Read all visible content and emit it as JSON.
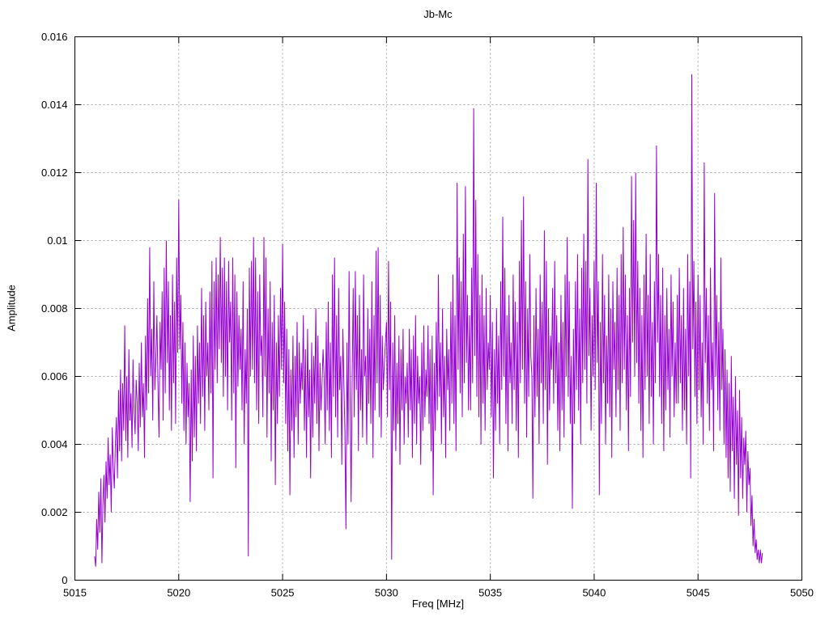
{
  "figure": {
    "background": "#ffffff",
    "frame_color": "#000000",
    "grid_color": "#a6a6a6"
  },
  "chart_data": {
    "type": "line",
    "title": "Jb-Mc",
    "xlabel": "Freq [MHz]",
    "ylabel": "Amplitude",
    "xlim": [
      5015,
      5050
    ],
    "ylim": [
      0,
      0.016
    ],
    "grid": true,
    "legend_position": "none",
    "x_ticks": [
      5015,
      5020,
      5025,
      5030,
      5035,
      5040,
      5045,
      5050
    ],
    "x_tick_labels": [
      "5015",
      "5020",
      "5025",
      "5030",
      "5035",
      "5040",
      "5045",
      "5050"
    ],
    "y_ticks": [
      0,
      0.002,
      0.004,
      0.006,
      0.008,
      0.01,
      0.012,
      0.014,
      0.016
    ],
    "y_tick_labels": [
      "0",
      "0.002",
      "0.004",
      "0.006",
      "0.008",
      "0.01",
      "0.012",
      "0.014",
      "0.016"
    ],
    "series": [
      {
        "name": "Jb-Mc",
        "color": "#9400d3",
        "x_start": 5015.95,
        "x_step": 0.05,
        "y_scale": 0.0001,
        "values": [
          7,
          4,
          18,
          9,
          26,
          14,
          30,
          5,
          22,
          31,
          17,
          35,
          24,
          42,
          28,
          37,
          20,
          45,
          33,
          27,
          40,
          48,
          30,
          56,
          38,
          62,
          35,
          58,
          44,
          75,
          41,
          60,
          36,
          68,
          47,
          55,
          39,
          65,
          50,
          43,
          59,
          52,
          38,
          64,
          45,
          70,
          48,
          58,
          36,
          72,
          50,
          83,
          55,
          98,
          60,
          74,
          47,
          88,
          56,
          66,
          78,
          58,
          42,
          76,
          62,
          85,
          47,
          92,
          55,
          100,
          64,
          88,
          50,
          78,
          44,
          90,
          58,
          82,
          46,
          95,
          67,
          112,
          68,
          84,
          52,
          76,
          44,
          70,
          40,
          64,
          48,
          58,
          23,
          62,
          35,
          72,
          42,
          66,
          38,
          75,
          52,
          70,
          46,
          86,
          54,
          78,
          44,
          82,
          60,
          70,
          50,
          85,
          55,
          94,
          30,
          88,
          62,
          95,
          58,
          90,
          68,
          101,
          64,
          92,
          54,
          95,
          60,
          88,
          50,
          94,
          70,
          82,
          47,
          95,
          55,
          90,
          33,
          85,
          57,
          78,
          62,
          74,
          50,
          88,
          40,
          68,
          52,
          80,
          7,
          92,
          60,
          94,
          62,
          101,
          58,
          95,
          50,
          85,
          46,
          90,
          66,
          72,
          48,
          101,
          60,
          95,
          42,
          80,
          55,
          88,
          35,
          76,
          50,
          84,
          28,
          70,
          46,
          78,
          54,
          86,
          62,
          99,
          58,
          82,
          46,
          74,
          38,
          68,
          25,
          62,
          44,
          72,
          36,
          66,
          48,
          76,
          40,
          70,
          52,
          64,
          56,
          78,
          44,
          68,
          36,
          74,
          48,
          62,
          30,
          70,
          42,
          66,
          52,
          80,
          46,
          72,
          38,
          64,
          50,
          58,
          68,
          60,
          40,
          76,
          50,
          82,
          44,
          70,
          36,
          90,
          54,
          95,
          48,
          78,
          42,
          86,
          56,
          66,
          34,
          74,
          58,
          44,
          15,
          70,
          40,
          91,
          52,
          23,
          60,
          86,
          48,
          91,
          56,
          78,
          38,
          84,
          50,
          68,
          42,
          90,
          60,
          66,
          40,
          80,
          52,
          74,
          46,
          88,
          36,
          78,
          50,
          97,
          58,
          98,
          48,
          84,
          42,
          72,
          56,
          64,
          70,
          76,
          48,
          94,
          56,
          82,
          6,
          70,
          44,
          78,
          38,
          64,
          46,
          72,
          34,
          68,
          50,
          74,
          40,
          60,
          52,
          64,
          42,
          74,
          50,
          68,
          36,
          72,
          46,
          78,
          40,
          66,
          52,
          60,
          34,
          70,
          44,
          75,
          48,
          62,
          54,
          75,
          46,
          68,
          38,
          72,
          25,
          64,
          44,
          76,
          50,
          90,
          54,
          70,
          40,
          80,
          48,
          66,
          36,
          74,
          56,
          68,
          44,
          82,
          52,
          90,
          46,
          78,
          38,
          117,
          62,
          95,
          55,
          88,
          48,
          102,
          58,
          116,
          64,
          84,
          50,
          78,
          50,
          92,
          58,
          139,
          66,
          112,
          54,
          96,
          48,
          84,
          40,
          90,
          52,
          78,
          44,
          86,
          56,
          70,
          62,
          84,
          48,
          76,
          30,
          68,
          44,
          80,
          52,
          72,
          40,
          88,
          56,
          107,
          60,
          92,
          46,
          78,
          38,
          84,
          58,
          70,
          46,
          90,
          56,
          82,
          44,
          76,
          36,
          94,
          58,
          106,
          62,
          113,
          52,
          88,
          42,
          80,
          54,
          96,
          66,
          60,
          24,
          78,
          48,
          86,
          54,
          74,
          40,
          90,
          58,
          82,
          46,
          103,
          56,
          94,
          34,
          80,
          50,
          72,
          62,
          86,
          52,
          94,
          58,
          78,
          44,
          70,
          38,
          84,
          50,
          76,
          42,
          90,
          60,
          101,
          54,
          88,
          46,
          66,
          21,
          74,
          46,
          88,
          56,
          96,
          50,
          80,
          40,
          92,
          58,
          102,
          62,
          94,
          52,
          124,
          66,
          86,
          44,
          78,
          60,
          94,
          56,
          117,
          64,
          88,
          25,
          76,
          46,
          96,
          58,
          84,
          40,
          72,
          52,
          90,
          48,
          80,
          36,
          88,
          62,
          76,
          48,
          92,
          56,
          84,
          44,
          96,
          58,
          104,
          62,
          90,
          50,
          78,
          38,
          86,
          54,
          119,
          70,
          106,
          60,
          120,
          64,
          94,
          52,
          86,
          44,
          78,
          36,
          90,
          56,
          102,
          60,
          84,
          46,
          96,
          54,
          76,
          40,
          88,
          58,
          128,
          70,
          96,
          54,
          84,
          46,
          92,
          38,
          78,
          50,
          86,
          56,
          74,
          42,
          90,
          60,
          82,
          48,
          70,
          52,
          84,
          52,
          92,
          58,
          78,
          44,
          86,
          50,
          74,
          40,
          96,
          60,
          88,
          30,
          149,
          68,
          94,
          54,
          82,
          46,
          90,
          56,
          84,
          48,
          70,
          40,
          123,
          64,
          86,
          52,
          78,
          44,
          92,
          56,
          70,
          38,
          114,
          60,
          84,
          50,
          76,
          44,
          95,
          56,
          74,
          40,
          68,
          36,
          62,
          30,
          58,
          26,
          66,
          38,
          54,
          24,
          60,
          34,
          50,
          19,
          56,
          30,
          48,
          24,
          42,
          34,
          44,
          20,
          38,
          28,
          33,
          16,
          25,
          10,
          18,
          8,
          12,
          6,
          9,
          5,
          9,
          5,
          8
        ]
      }
    ]
  }
}
